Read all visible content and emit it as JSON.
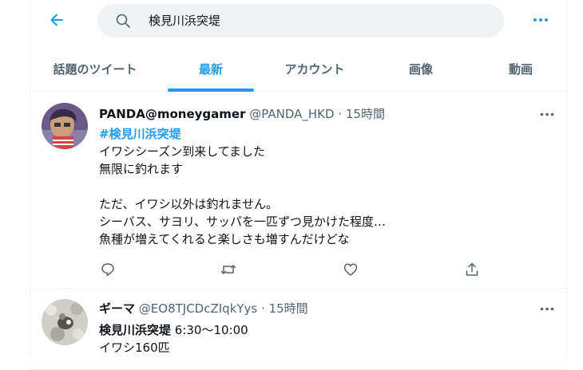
{
  "search": {
    "query": "検見川浜突堤"
  },
  "tabs": [
    {
      "label": "話題のツイート",
      "active": false
    },
    {
      "label": "最新",
      "active": true
    },
    {
      "label": "アカウント",
      "active": false
    },
    {
      "label": "画像",
      "active": false
    },
    {
      "label": "動画",
      "active": false
    }
  ],
  "tweets": [
    {
      "name": "PANDA@moneygamer",
      "handle": "@PANDA_HKD",
      "sep": "·",
      "time": "15時間",
      "hashtag": "#検見川浜突堤",
      "lines": [
        "イワシシーズン到来してました",
        "無限に釣れます",
        "",
        "ただ、イワシ以外は釣れません。",
        "シーバス、サヨリ、サッパを一匹ずつ見かけた程度…",
        "魚種が増えてくれると楽しさも増すんだけどな"
      ]
    },
    {
      "name": "ギーマ",
      "handle": "@EO8TJCDcZIqkYys",
      "sep": "·",
      "time": "15時間",
      "bold_prefix": "検見川浜突堤",
      "first_line_rest": " 6:30〜10:00",
      "line2": "イワシ160匹"
    }
  ],
  "colors": {
    "accent": "#1d9bf0",
    "muted": "#536471",
    "text": "#0f1419",
    "divider": "#eff3f4"
  },
  "icons": {
    "back": "arrow-left-icon",
    "search": "search-icon",
    "more": "more-icon",
    "reply": "reply-icon",
    "retweet": "retweet-icon",
    "like": "heart-icon",
    "share": "share-icon"
  }
}
